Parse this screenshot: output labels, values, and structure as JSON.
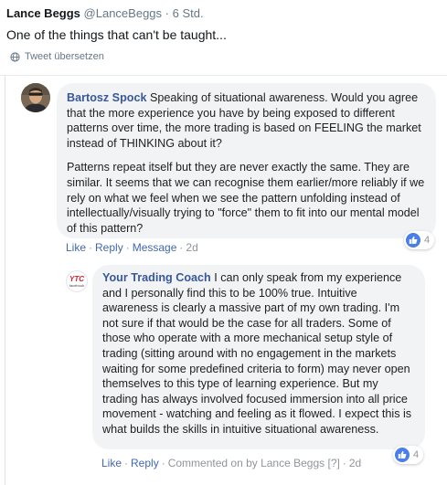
{
  "tweet": {
    "author_name": "Lance Beggs",
    "handle": "@LanceBeggs",
    "dot": "·",
    "time": "6 Std.",
    "text": "One of the things that can't be taught...",
    "translate_label": "Tweet übersetzen"
  },
  "comments": [
    {
      "author": "Bartosz Spock",
      "text_1": "Speaking of situational awareness. Would you agree that the more experience you have by being exposed to different patterns over time, the more trading is based on FEELING the market instead of THINKING about it?",
      "text_2": "Patterns repeat itself but they are never exactly the same. They are similar. It seems that we can recognise them earlier/more reliably if we rely on what we feel when we see the pattern unfolding instead of intellectually/visually trying to \"force\" them to fit into our mental model of this pattern?",
      "actions": {
        "like": "Like",
        "reply": "Reply",
        "message": "Message",
        "time": "2d"
      },
      "reaction_count": "4"
    },
    {
      "author": "Your Trading Coach",
      "avatar_text": "YTC",
      "avatar_subtext": "facebook",
      "text": "I can only speak from my experience and I personally find this to be 100% true. Intuitive awareness is clearly a massive part of my own trading. I'm not sure if that would be the case for all traders. Some of those who operate with a more mechanical setup style of trading (sitting around with no engagement in the markets waiting for some predefined criteria to form) may never open themselves to this type of learning experience. But my trading has always involved focused immersion into all price movement - watching and feeling as it flowed. I expect this is what builds the skills in intuitive situational awareness.",
      "actions": {
        "like": "Like",
        "reply": "Reply",
        "commented_on_by": "Commented on by Lance Beggs",
        "help": "[?]",
        "time": "2d"
      },
      "reaction_count": "4"
    }
  ],
  "colors": {
    "link": "#385898",
    "action": "#4267b2",
    "bubble": "#f2f3f5",
    "like": "#4a7ee8"
  },
  "icons": {
    "translate": "globe-icon",
    "like": "thumbs-up-icon"
  }
}
